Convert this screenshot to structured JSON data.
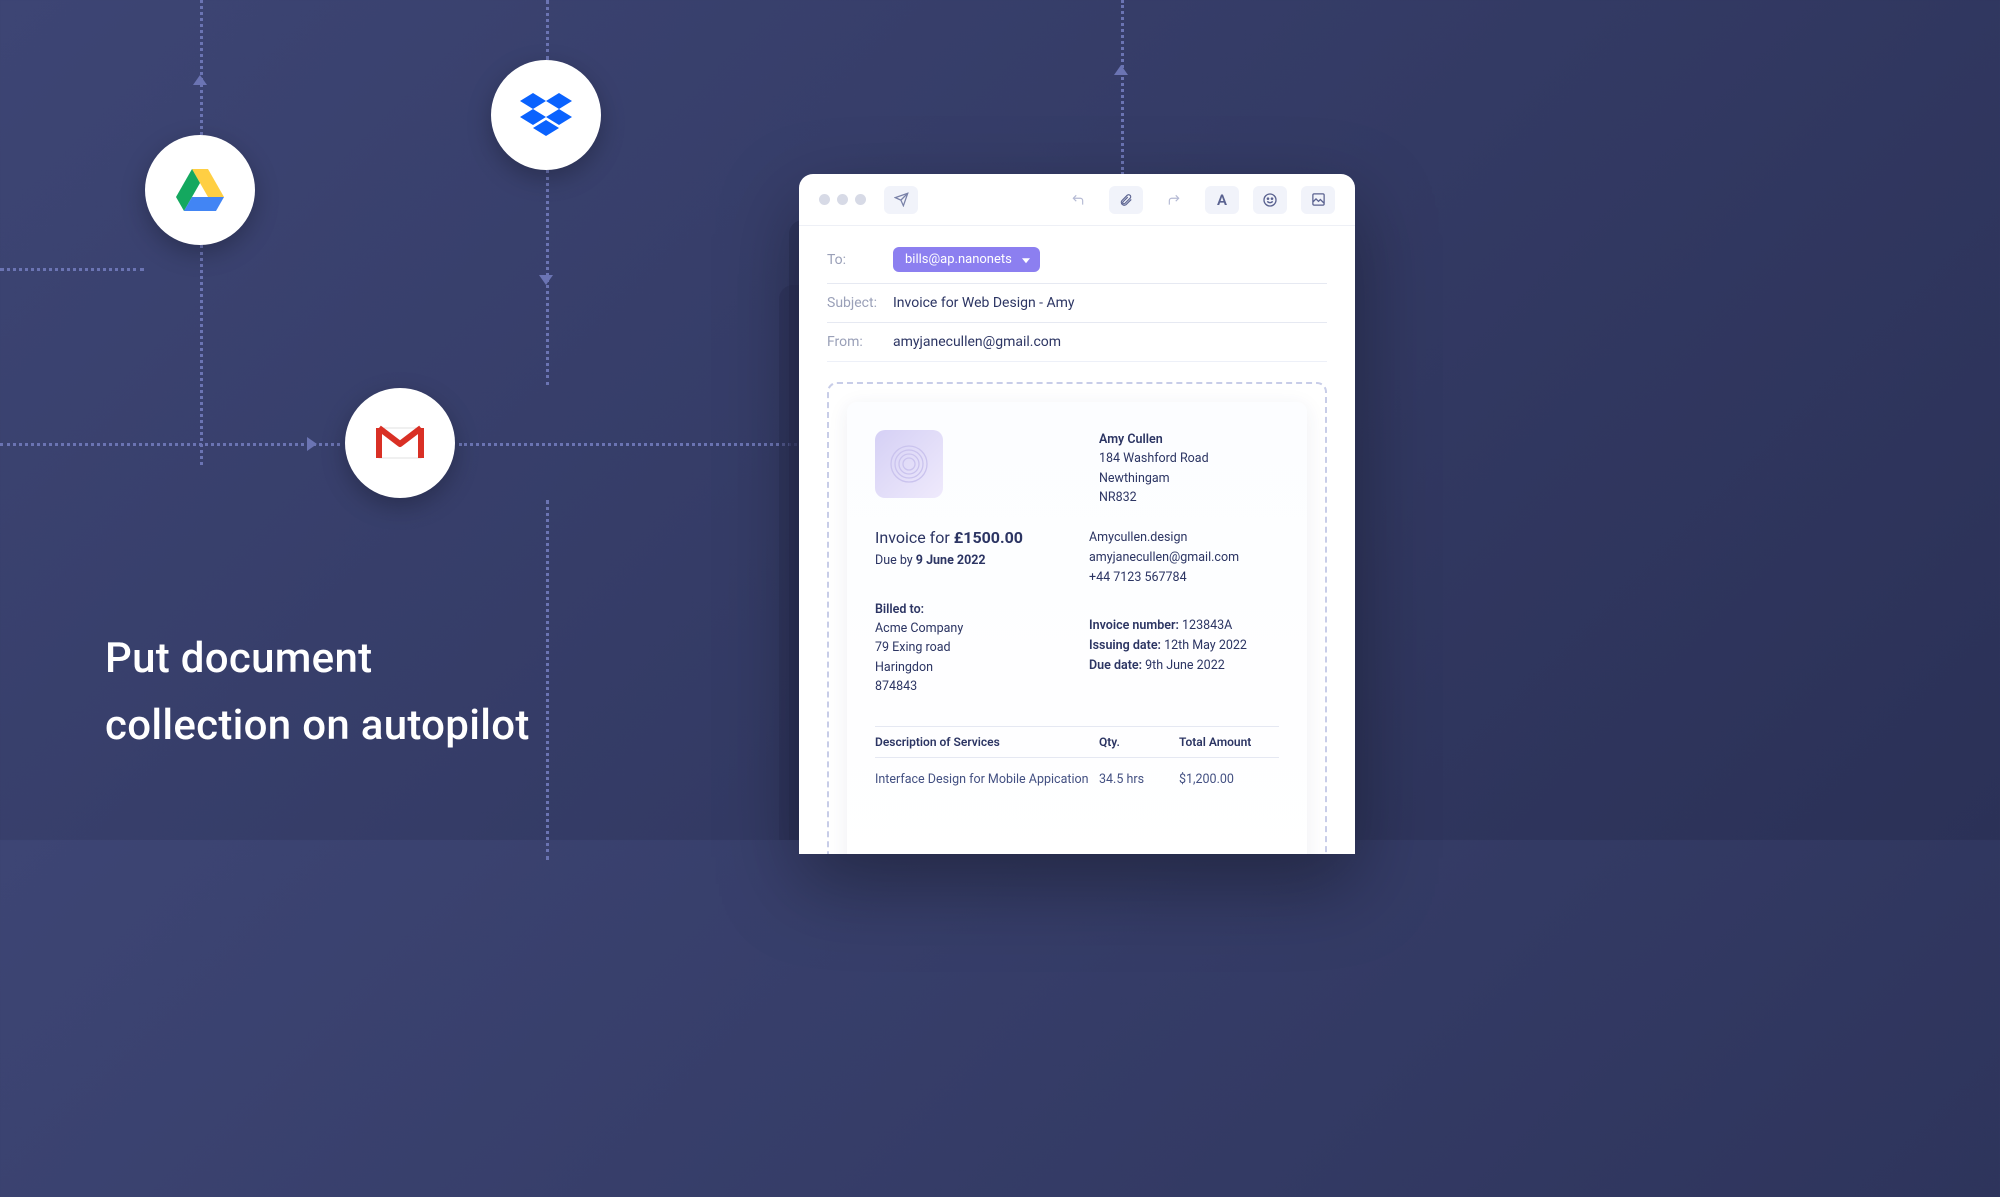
{
  "heading_line1": "Put document",
  "heading_line2": "collection on autopilot",
  "email": {
    "to_label": "To:",
    "to_chip": "bills@ap.nanonets",
    "subject_label": "Subject:",
    "subject_value": "Invoice for Web Design - Amy",
    "from_label": "From:",
    "from_value": "amyjanecullen@gmail.com"
  },
  "invoice": {
    "sender": {
      "name": "Amy Cullen",
      "line1": "184 Washford Road",
      "line2": "Newthingam",
      "line3": "NR832",
      "site": "Amycullen.design",
      "email": "amyjanecullen@gmail.com",
      "phone": "+44 7123 567784"
    },
    "title_prefix": "Invoice for ",
    "title_amount": "£1500.00",
    "due_prefix": "Due by ",
    "due_date": "9 June 2022",
    "billed_label": "Billed to:",
    "billed": {
      "company": "Acme Company",
      "line1": "79 Exing road",
      "line2": "Haringdon",
      "line3": "874843"
    },
    "meta": {
      "invno_label": "Invoice number: ",
      "invno": "123843A",
      "issue_label": "Issuing date: ",
      "issue": "12th May 2022",
      "due_label": "Due date: ",
      "due": "9th June 2022"
    },
    "cols": {
      "desc": "Description of Services",
      "qty": "Qty.",
      "amt": "Total Amount"
    },
    "row": {
      "desc": "Interface Design for Mobile Appication",
      "qty": "34.5 hrs",
      "amt": "$1,200.00"
    }
  }
}
